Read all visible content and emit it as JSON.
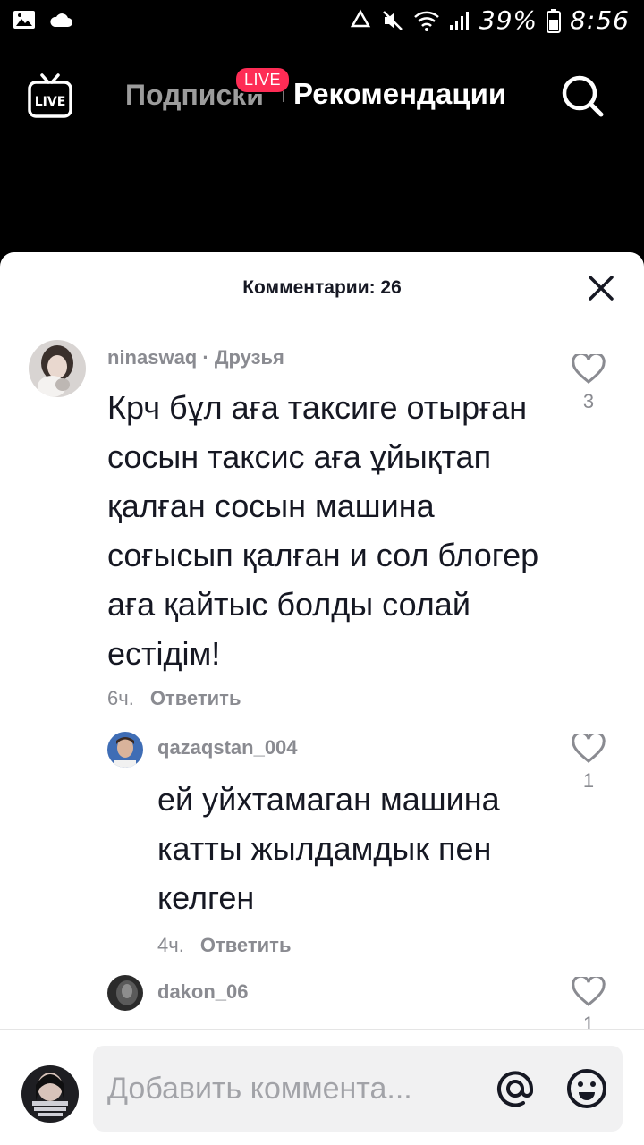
{
  "status_bar": {
    "battery": "39%",
    "time": "8:56",
    "icons": [
      "gallery-icon",
      "cloud-icon",
      "recycle-icon",
      "mute-icon",
      "wifi-icon",
      "signal-icon",
      "battery-icon"
    ]
  },
  "top_nav": {
    "live_icon_label": "LIVE",
    "tab_following": "Подписки",
    "live_badge": "LIVE",
    "tab_for_you": "Рекомендации",
    "accent_color": "#fe2c55"
  },
  "comments_sheet": {
    "title": "Комментарии: 26",
    "comments": [
      {
        "username": "ninaswaq",
        "tag": "· Друзья",
        "text": "Крч бұл аға таксиге отырған сосын таксис аға ұйықтап қалған сосын машина соғысып қалған и сол блогер аға қайтыс болды солай естідім!",
        "time": "6ч.",
        "reply_label": "Ответить",
        "likes": "3"
      },
      {
        "username": "qazaqstan_004",
        "text": "ей уйхтамаган машина катты жылдамдык пен келген",
        "time": "4ч.",
        "reply_label": "Ответить",
        "likes": "1"
      },
      {
        "username": "dakon_06",
        "likes": "1"
      }
    ]
  },
  "input_bar": {
    "placeholder": "Добавить коммента..."
  }
}
